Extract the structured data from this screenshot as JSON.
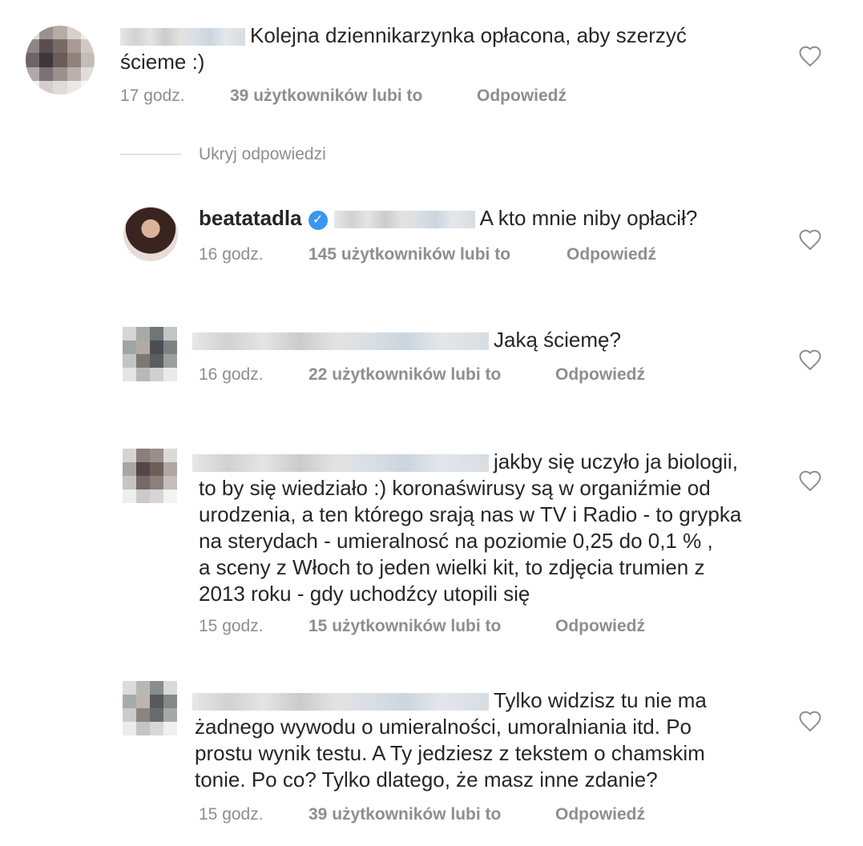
{
  "comments": [
    {
      "text": "Kolejna dziennikarzynka opłacona, aby szerzyć ściemę :)",
      "line1": "Kolejna dziennikarzynka opłacona, aby szerzyć",
      "line2": "ścieme :)",
      "time": "17 godz.",
      "likes": "39 użytkowników lubi to",
      "reply": "Odpowiedź"
    },
    {
      "username": "beatatadla",
      "text": "A kto mnie niby opłacił?",
      "time": "16 godz.",
      "likes": "145 użytkowników lubi to",
      "reply": "Odpowiedź"
    },
    {
      "text": "Jaką ściemę?",
      "time": "16 godz.",
      "likes": "22 użytkowników lubi to",
      "reply": "Odpowiedź"
    },
    {
      "lines": [
        "jakby się uczyło ja biologii,",
        "to by się wiedziało :) koronaświrusy są w organiźmie od",
        "urodzenia, a ten którego srają nas w TV i Radio - to grypka",
        "na sterydach - umieralnosć na poziomie 0,25 do 0,1 % ,",
        "a sceny z Włoch to jeden wielki kit, to zdjęcia trumien z",
        "2013 roku - gdy uchodźcy utopili się"
      ],
      "time": "15 godz.",
      "likes": "15 użytkowników lubi to",
      "reply": "Odpowiedź"
    },
    {
      "lines": [
        "Tylko widzisz tu nie ma",
        "żadnego wywodu o umieralności, umoralniania itd. Po",
        "prostu wynik testu. A Ty jedziesz z tekstem o chamskim",
        "tonie. Po co? Tylko dlatego, że masz inne zdanie?"
      ],
      "time": "15 godz.",
      "likes": "39 użytkowników lubi to",
      "reply": "Odpowiedź"
    }
  ],
  "hide_replies": "Ukryj odpowiedzi",
  "colors": {
    "text": "#262626",
    "meta": "#8e8e8e",
    "verified": "#3897f0",
    "heart": "#8e8e8e"
  },
  "icons": {
    "like": "heart-outline-icon",
    "verified": "verified-badge-icon"
  }
}
